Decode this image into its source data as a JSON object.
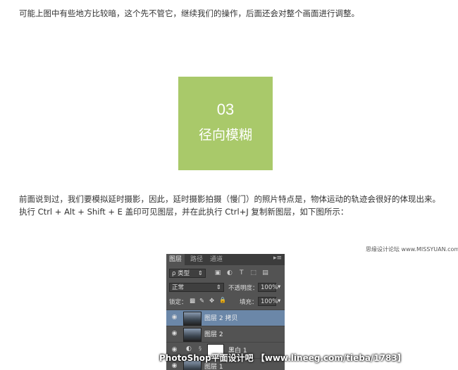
{
  "article": {
    "paragraph1": "可能上图中有些地方比较暗，这个先不管它，继续我们的操作，后面还会对整个画面进行调整。",
    "section_number": "03",
    "section_title": "径向模糊",
    "paragraph2": "前面说到过，我们要模拟延时摄影，因此，延时摄影拍摄（慢门）的照片特点是，物体运动的轨迹会很好的体现出来。",
    "paragraph3": "执行 Ctrl + Alt + Shift + E 盖印可见图层，并在此执行 Ctrl+J 复制新图层，如下图所示："
  },
  "credit": "思缘设计论坛 www.MISSYUAN.com",
  "colors": {
    "hero_bg": "#a9c96a",
    "panel_bg": "#535353",
    "selected_layer": "#6b87a8"
  },
  "panel": {
    "tabs": [
      "图层",
      "路径",
      "通道"
    ],
    "menu_glyph": "▸≡",
    "filter_label": "ρ 类型",
    "filter_arrow": "⇕",
    "filter_icons": [
      "▣",
      "◐",
      "T",
      "⬚",
      "▤"
    ],
    "blend_mode": "正常",
    "blend_arrow": "⇕",
    "opacity_label": "不透明度：",
    "opacity_value": "100%",
    "opacity_arrow": "▾",
    "lock_label": "锁定：",
    "lock_icons": [
      "▩",
      "✎",
      "✥",
      "🔒"
    ],
    "fill_label": "填充：",
    "fill_value": "100%",
    "fill_arrow": "▾",
    "layers": [
      {
        "name": "图层 2 拷贝",
        "selected": true
      },
      {
        "name": "图层 2",
        "selected": false
      },
      {
        "name": "黑白 1",
        "selected": false,
        "adjustment": true
      },
      {
        "name": "图层 1",
        "selected": false
      }
    ]
  },
  "watermark": "PhotoShop平面设计吧 【www.lineeg.com/tieba/1783】"
}
